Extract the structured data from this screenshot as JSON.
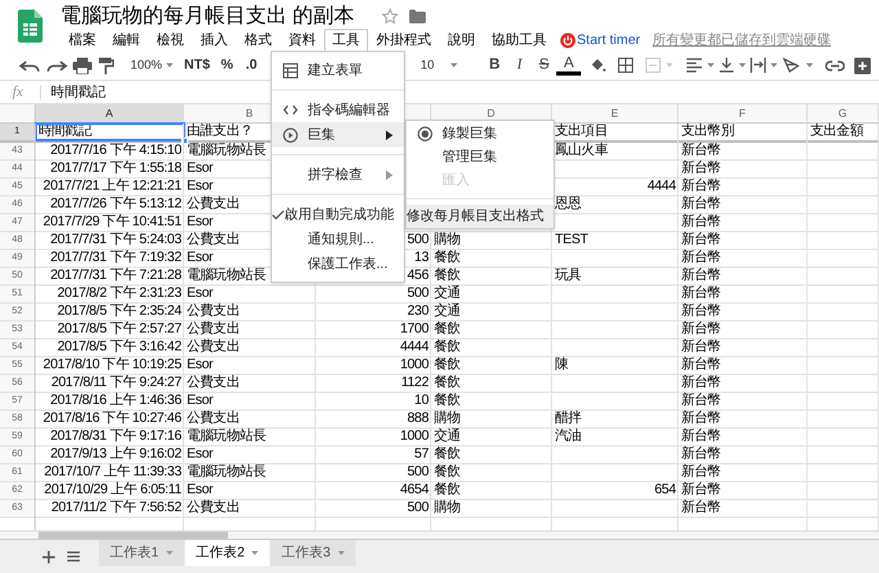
{
  "app": {
    "title": "電腦玩物的每月帳目支出 的副本",
    "save_status": "所有變更都已儲存到雲端硬碟"
  },
  "menu_bar": [
    {
      "label": "檔案",
      "selected": false
    },
    {
      "label": "編輯",
      "selected": false
    },
    {
      "label": "檢視",
      "selected": false
    },
    {
      "label": "插入",
      "selected": false
    },
    {
      "label": "格式",
      "selected": false
    },
    {
      "label": "資料",
      "selected": false
    },
    {
      "label": "工具",
      "selected": true
    },
    {
      "label": "外掛程式",
      "selected": false
    },
    {
      "label": "說明",
      "selected": false
    },
    {
      "label": "協助工具",
      "selected": false
    }
  ],
  "timer_button": {
    "label": "Start timer"
  },
  "toolbar": {
    "zoom": "100%",
    "currency_format": "NT$",
    "percent_format": "%",
    "decimal_format": ".0",
    "font_size": "10",
    "bold": "B",
    "italic": "I",
    "strikethrough": "S",
    "text_color": "A"
  },
  "formula_bar": {
    "fx": "fx",
    "value": "時間戳記"
  },
  "columns": [
    {
      "label": "A",
      "selected": true
    },
    {
      "label": "B",
      "selected": false
    },
    null,
    {
      "label": "D",
      "selected": false
    },
    {
      "label": "E",
      "selected": false
    },
    {
      "label": "F",
      "selected": false
    },
    {
      "label": "G",
      "selected": false
    }
  ],
  "frozen_row": {
    "number": "1",
    "selected": true,
    "cells": [
      {
        "text": "時間戳記",
        "selected": true
      },
      {
        "text": "由誰支出？",
        "selected": false
      },
      null,
      null,
      {
        "text": "支出項目",
        "selected": false
      },
      {
        "text": "支出幣別",
        "selected": false
      },
      {
        "text": "支出金額",
        "selected": false
      }
    ]
  },
  "rows": [
    {
      "number": "43",
      "cells": [
        "2017/7/16 下午 4:15:10",
        "電腦玩物站長",
        null,
        null,
        "鳳山火車",
        "新台幣",
        null
      ]
    },
    {
      "number": "44",
      "cells": [
        "2017/7/17 下午 1:55:18",
        "Esor",
        null,
        null,
        null,
        "新台幣",
        null
      ]
    },
    {
      "number": "45",
      "cells": [
        "2017/7/21 上午 12:21:21",
        "Esor",
        null,
        null,
        "4444",
        "新台幣",
        null
      ]
    },
    {
      "number": "46",
      "cells": [
        "2017/7/26 下午 5:13:12",
        "公費支出",
        null,
        null,
        "恩恩",
        "新台幣",
        null
      ]
    },
    {
      "number": "47",
      "cells": [
        "2017/7/29 下午 10:41:51",
        "Esor",
        null,
        null,
        null,
        "新台幣",
        null
      ]
    },
    {
      "number": "48",
      "cells": [
        "2017/7/31 下午 5:24:03",
        "公費支出",
        "500",
        "購物",
        "TEST",
        "新台幣",
        null
      ]
    },
    {
      "number": "49",
      "cells": [
        "2017/7/31 下午 7:19:32",
        "Esor",
        "13",
        "餐飲",
        null,
        "新台幣",
        null
      ]
    },
    {
      "number": "50",
      "cells": [
        "2017/7/31 下午 7:21:28",
        "電腦玩物站長",
        "456",
        "餐飲",
        "玩具",
        "新台幣",
        null
      ]
    },
    {
      "number": "51",
      "cells": [
        "2017/8/2 下午 2:31:23",
        "Esor",
        "500",
        "交通",
        null,
        "新台幣",
        null
      ]
    },
    {
      "number": "52",
      "cells": [
        "2017/8/5 下午 2:35:24",
        "公費支出",
        "230",
        "交通",
        null,
        "新台幣",
        null
      ]
    },
    {
      "number": "53",
      "cells": [
        "2017/8/5 下午 2:57:27",
        "公費支出",
        "1700",
        "餐飲",
        null,
        "新台幣",
        null
      ]
    },
    {
      "number": "54",
      "cells": [
        "2017/8/5 下午 3:16:42",
        "公費支出",
        "4444",
        "餐飲",
        null,
        "新台幣",
        null
      ]
    },
    {
      "number": "55",
      "cells": [
        "2017/8/10 下午 10:19:25",
        "Esor",
        "1000",
        "餐飲",
        "陳",
        "新台幣",
        null
      ]
    },
    {
      "number": "56",
      "cells": [
        "2017/8/11 下午 9:24:27",
        "公費支出",
        "1122",
        "餐飲",
        null,
        "新台幣",
        null
      ]
    },
    {
      "number": "57",
      "cells": [
        "2017/8/16 上午 1:46:36",
        "Esor",
        "10",
        "餐飲",
        null,
        "新台幣",
        null
      ]
    },
    {
      "number": "58",
      "cells": [
        "2017/8/16 下午 10:27:46",
        "公費支出",
        "888",
        "購物",
        "醋拌",
        "新台幣",
        null
      ]
    },
    {
      "number": "59",
      "cells": [
        "2017/8/31 下午 9:17:16",
        "電腦玩物站長",
        "1000",
        "交通",
        "汽油",
        "新台幣",
        null
      ]
    },
    {
      "number": "60",
      "cells": [
        "2017/9/13 上午 9:16:02",
        "Esor",
        "57",
        "餐飲",
        null,
        "新台幣",
        null
      ]
    },
    {
      "number": "61",
      "cells": [
        "2017/10/7 上午 11:39:33",
        "電腦玩物站長",
        "500",
        "餐飲",
        null,
        "新台幣",
        null
      ]
    },
    {
      "number": "62",
      "cells": [
        "2017/10/29 上午 6:05:11",
        "Esor",
        "4654",
        "餐飲",
        "654",
        "新台幣",
        null
      ]
    },
    {
      "number": "63",
      "cells": [
        "2017/11/2 下午 7:56:52",
        "公費支出",
        "500",
        "購物",
        null,
        "新台幣",
        null
      ]
    }
  ],
  "tools_menu": [
    {
      "kind": "form",
      "label": "建立表單",
      "selected": false
    },
    {
      "kind": "separator"
    },
    {
      "kind": "code",
      "label": "指令碼編輯器",
      "selected": false
    },
    {
      "kind": "play_submenu",
      "label": "巨集",
      "selected": true
    },
    {
      "kind": "separator"
    },
    {
      "kind": "submenu",
      "label": "拼字檢查",
      "selected": false
    },
    {
      "kind": "separator"
    },
    {
      "kind": "check",
      "label": "啟用自動完成功能",
      "selected": false,
      "checked": true
    },
    {
      "kind": "plain",
      "label": "通知規則...",
      "selected": false
    },
    {
      "kind": "plain",
      "label": "保護工作表...",
      "selected": false
    }
  ],
  "macro_submenu": [
    {
      "kind": "record",
      "label": "錄製巨集",
      "selected": false,
      "disabled": false
    },
    {
      "kind": "plain",
      "label": "管理巨集",
      "selected": false,
      "disabled": false
    },
    {
      "kind": "plain",
      "label": "匯入",
      "selected": false,
      "disabled": true
    },
    {
      "kind": "separator"
    },
    {
      "kind": "plain",
      "label": "修改每月帳目支出格式",
      "selected": true,
      "disabled": false
    }
  ],
  "sheet_tabs": [
    {
      "label": "工作表1",
      "selected": false
    },
    {
      "label": "工作表2",
      "selected": true
    },
    {
      "label": "工作表3",
      "selected": false
    }
  ]
}
